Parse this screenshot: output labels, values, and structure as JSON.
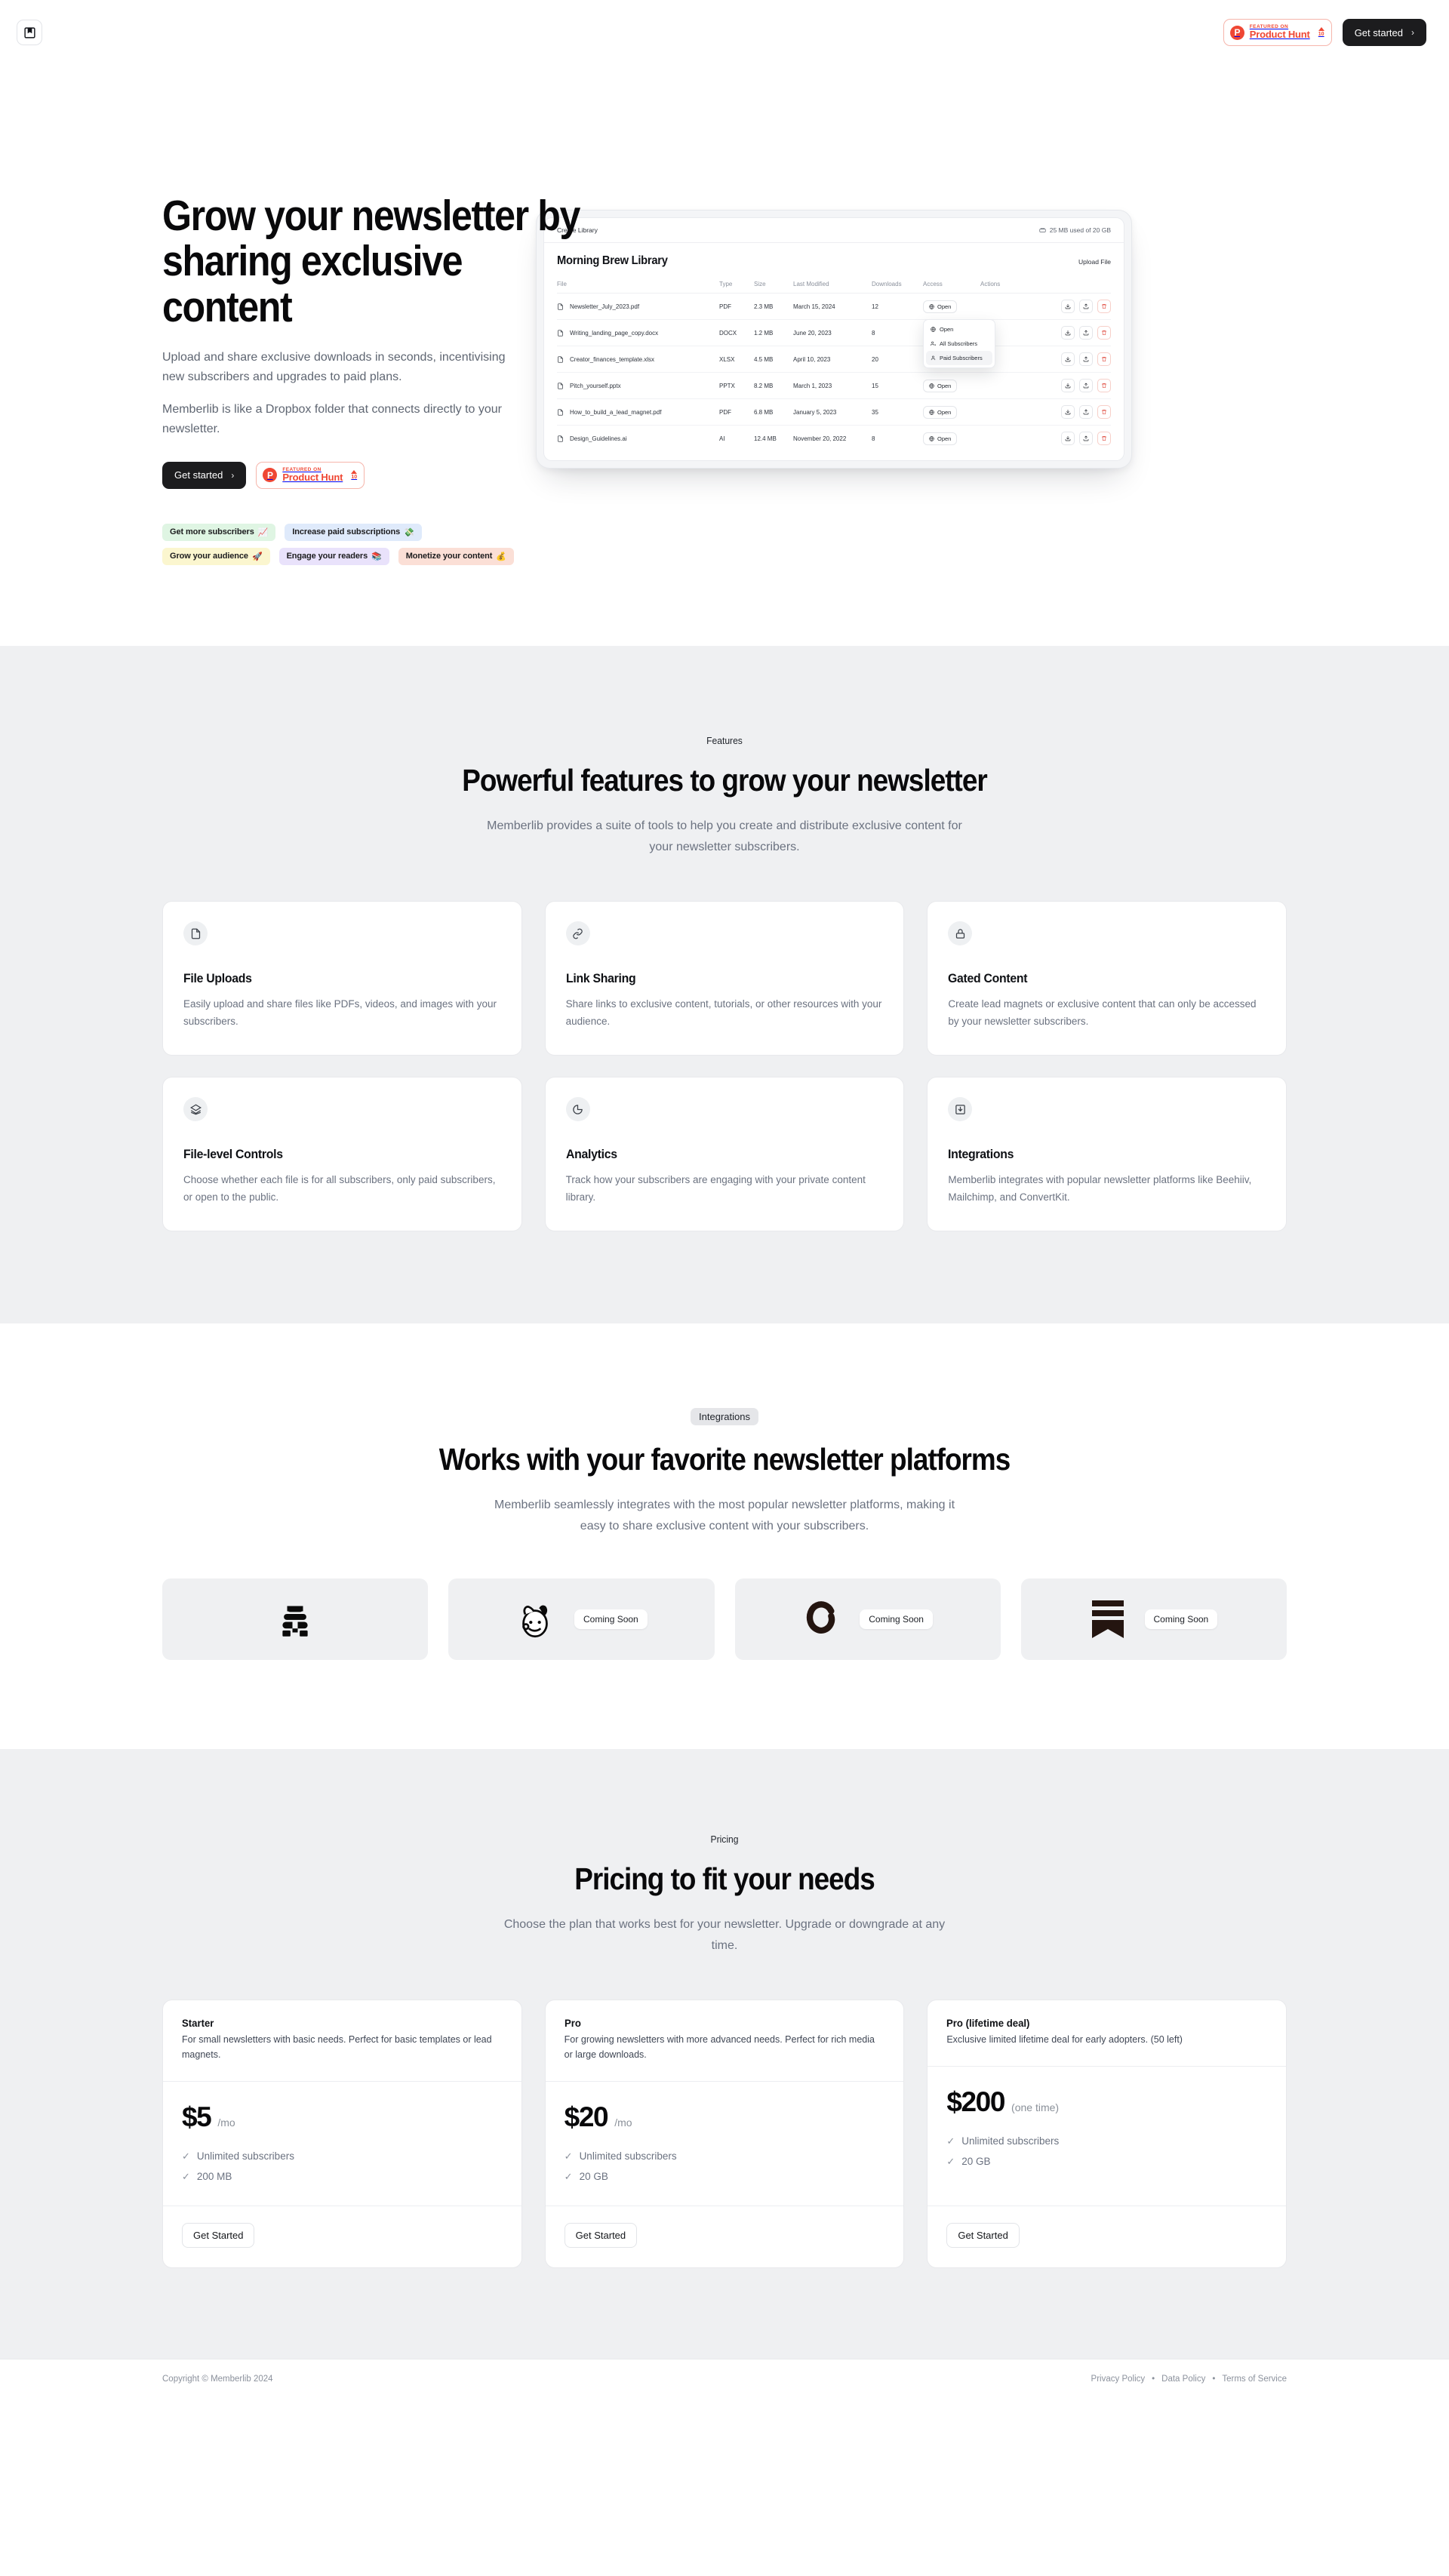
{
  "header": {
    "logo_icon": "bookmark-logo-icon",
    "product_hunt": {
      "kicker": "FEATURED ON",
      "name": "Product Hunt",
      "votes": "10"
    },
    "cta": {
      "label": "Get started",
      "chevron": "›"
    }
  },
  "hero": {
    "heading": "Grow your newsletter by sharing exclusive content",
    "paragraph1": "Upload and share exclusive downloads in seconds, incentivising new subscribers and upgrades to paid plans.",
    "paragraph2": "Memberlib is like a Dropbox folder that connects directly to your newsletter.",
    "cta": {
      "label": "Get started",
      "chevron": "›"
    },
    "product_hunt": {
      "kicker": "FEATURED ON",
      "name": "Product Hunt",
      "votes": "10"
    },
    "tags": [
      {
        "label": "Get more subscribers",
        "emoji": "📈",
        "bg": "#dff5e3"
      },
      {
        "label": "Increase paid subscriptions",
        "emoji": "💸",
        "bg": "#dfeafb"
      },
      {
        "label": "Grow your audience",
        "emoji": "🚀",
        "bg": "#fbf6cf"
      },
      {
        "label": "Engage your readers",
        "emoji": "📚",
        "bg": "#e9e2fb"
      },
      {
        "label": "Monetize your content",
        "emoji": "💰",
        "bg": "#fbdfd6"
      }
    ]
  },
  "app_mock": {
    "topbar": {
      "create_library": "Create Library",
      "storage": "25 MB used of 20 GB"
    },
    "library_title": "Morning Brew Library",
    "upload_label": "Upload File",
    "columns": [
      "File",
      "Type",
      "Size",
      "Last Modified",
      "Downloads",
      "Access",
      "Actions"
    ],
    "access_label": "Open",
    "rows": [
      {
        "file": "Newsletter_July_2023.pdf",
        "type": "PDF",
        "size": "2.3 MB",
        "modified": "March 15, 2024",
        "downloads": "12"
      },
      {
        "file": "Writing_landing_page_copy.docx",
        "type": "DOCX",
        "size": "1.2 MB",
        "modified": "June 20, 2023",
        "downloads": "8"
      },
      {
        "file": "Creator_finances_template.xlsx",
        "type": "XLSX",
        "size": "4.5 MB",
        "modified": "April 10, 2023",
        "downloads": "20"
      },
      {
        "file": "Pitch_yourself.pptx",
        "type": "PPTX",
        "size": "8.2 MB",
        "modified": "March 1, 2023",
        "downloads": "15"
      },
      {
        "file": "How_to_build_a_lead_magnet.pdf",
        "type": "PDF",
        "size": "6.8 MB",
        "modified": "January 5, 2023",
        "downloads": "35"
      },
      {
        "file": "Design_Guidelines.ai",
        "type": "AI",
        "size": "12.4 MB",
        "modified": "November 20, 2022",
        "downloads": "8"
      }
    ],
    "access_menu": [
      {
        "label": "Open",
        "icon": "globe-icon",
        "active": false
      },
      {
        "label": "All Subscribers",
        "icon": "users-icon",
        "active": false
      },
      {
        "label": "Paid Subscribers",
        "icon": "user-icon",
        "active": true
      }
    ]
  },
  "features": {
    "eyebrow": "Features",
    "heading": "Powerful features to grow your newsletter",
    "subheading": "Memberlib provides a suite of tools to help you create and distribute exclusive content for your newsletter subscribers.",
    "cards": [
      {
        "icon": "file-icon",
        "title": "File Uploads",
        "desc": "Easily upload and share files like PDFs, videos, and images with your subscribers."
      },
      {
        "icon": "link-icon",
        "title": "Link Sharing",
        "desc": "Share links to exclusive content, tutorials, or other resources with your audience."
      },
      {
        "icon": "lock-icon",
        "title": "Gated Content",
        "desc": "Create lead magnets or exclusive content that can only be accessed by your newsletter subscribers."
      },
      {
        "icon": "layers-icon",
        "title": "File-level Controls",
        "desc": "Choose whether each file is for all subscribers, only paid subscribers, or open to the public."
      },
      {
        "icon": "pie-chart-icon",
        "title": "Analytics",
        "desc": "Track how your subscribers are engaging with your private content library."
      },
      {
        "icon": "inbox-download-icon",
        "title": "Integrations",
        "desc": "Memberlib integrates with popular newsletter platforms like Beehiiv, Mailchimp, and ConvertKit."
      }
    ]
  },
  "integrations": {
    "eyebrow": "Integrations",
    "heading": "Works with your favorite newsletter platforms",
    "subheading": "Memberlib seamlessly integrates with the most popular newsletter platforms, making it easy to share exclusive content with your subscribers.",
    "cards": [
      {
        "logo": "beehiiv-logo-icon",
        "badge": ""
      },
      {
        "logo": "mailchimp-logo-icon",
        "badge": "Coming Soon"
      },
      {
        "logo": "convertkit-logo-icon",
        "badge": "Coming Soon"
      },
      {
        "logo": "substack-logo-icon",
        "badge": "Coming Soon"
      }
    ]
  },
  "pricing": {
    "eyebrow": "Pricing",
    "heading": "Pricing to fit your needs",
    "subheading": "Choose the plan that works best for your newsletter. Upgrade or downgrade at any time.",
    "plans": [
      {
        "name": "Starter",
        "desc": "For small newsletters with basic needs. Perfect for basic templates or lead magnets.",
        "price": "$5",
        "per": "/mo",
        "features": [
          "Unlimited subscribers",
          "200 MB"
        ],
        "cta": "Get Started"
      },
      {
        "name": "Pro",
        "desc": "For growing newsletters with more advanced needs. Perfect for rich media or large downloads.",
        "price": "$20",
        "per": "/mo",
        "features": [
          "Unlimited subscribers",
          "20 GB"
        ],
        "cta": "Get Started"
      },
      {
        "name": "Pro (lifetime deal)",
        "desc": "Exclusive limited lifetime deal for early adopters. (50 left)",
        "price": "$200",
        "per": "(one time)",
        "features": [
          "Unlimited subscribers",
          "20 GB"
        ],
        "cta": "Get Started"
      }
    ]
  },
  "footer": {
    "copyright": "Copyright © Memberlib 2024",
    "links": [
      "Privacy Policy",
      "Data Policy",
      "Terms of Service"
    ],
    "separator": "•"
  }
}
